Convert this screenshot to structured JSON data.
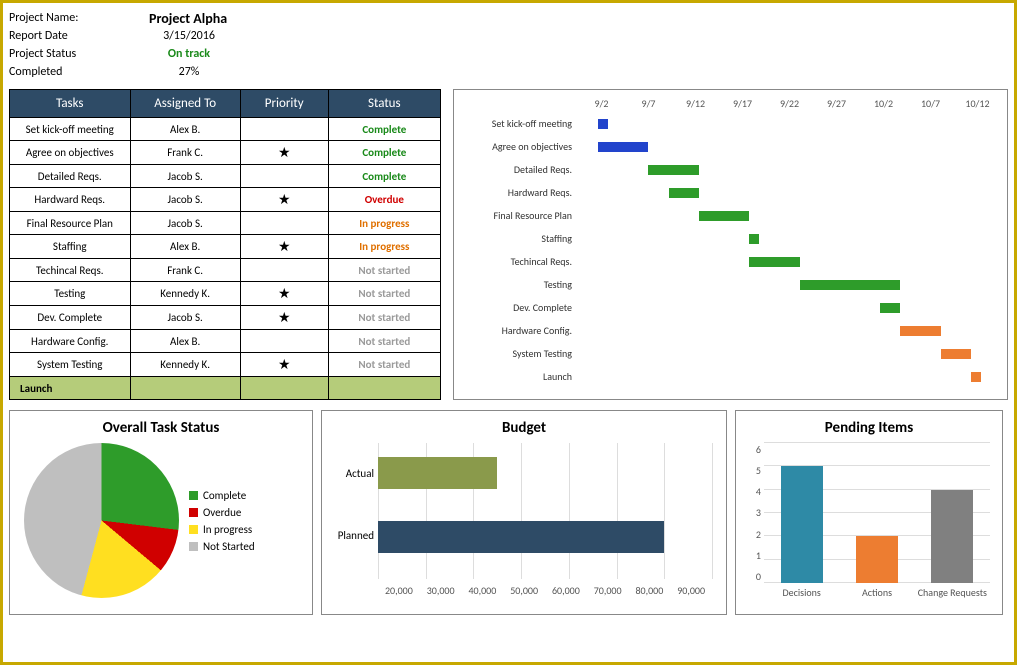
{
  "header": {
    "project_name_label": "Project Name:",
    "project_name": "Project Alpha",
    "report_date_label": "Report Date",
    "report_date": "3/15/2016",
    "project_status_label": "Project Status",
    "project_status": "On track",
    "completed_label": "Completed",
    "completed": "27%"
  },
  "tasks_table": {
    "headers": {
      "tasks": "Tasks",
      "assigned": "Assigned To",
      "priority": "Priority",
      "status": "Status"
    },
    "rows": [
      {
        "task": "Set kick-off meeting",
        "assigned": "Alex B.",
        "priority": "",
        "status": "Complete",
        "status_class": "complete"
      },
      {
        "task": "Agree on objectives",
        "assigned": "Frank C.",
        "priority": "★",
        "status": "Complete",
        "status_class": "complete"
      },
      {
        "task": "Detailed Reqs.",
        "assigned": "Jacob S.",
        "priority": "",
        "status": "Complete",
        "status_class": "complete"
      },
      {
        "task": "Hardward Reqs.",
        "assigned": "Jacob S.",
        "priority": "★",
        "status": "Overdue",
        "status_class": "overdue"
      },
      {
        "task": "Final Resource Plan",
        "assigned": "Jacob S.",
        "priority": "",
        "status": "In progress",
        "status_class": "inprogress"
      },
      {
        "task": "Staffing",
        "assigned": "Alex B.",
        "priority": "★",
        "status": "In progress",
        "status_class": "inprogress"
      },
      {
        "task": "Techincal Reqs.",
        "assigned": "Frank C.",
        "priority": "",
        "status": "Not started",
        "status_class": "notstarted"
      },
      {
        "task": "Testing",
        "assigned": "Kennedy K.",
        "priority": "★",
        "status": "Not started",
        "status_class": "notstarted"
      },
      {
        "task": "Dev. Complete",
        "assigned": "Jacob S.",
        "priority": "★",
        "status": "Not started",
        "status_class": "notstarted"
      },
      {
        "task": "Hardware Config.",
        "assigned": "Alex B.",
        "priority": "",
        "status": "Not started",
        "status_class": "notstarted"
      },
      {
        "task": "System Testing",
        "assigned": "Kennedy K.",
        "priority": "★",
        "status": "Not started",
        "status_class": "notstarted"
      }
    ],
    "launch_label": "Launch"
  },
  "chart_data": [
    {
      "type": "bar",
      "orientation": "horizontal-gantt",
      "title": "",
      "x_ticks": [
        "9/2",
        "9/7",
        "9/12",
        "9/17",
        "9/22",
        "9/27",
        "10/2",
        "10/7",
        "10/12"
      ],
      "tasks": [
        {
          "name": "Set kick-off meeting",
          "start": 2,
          "dur": 1,
          "color": "#2244cc"
        },
        {
          "name": "Agree on objectives",
          "start": 2,
          "dur": 5,
          "color": "#2244cc"
        },
        {
          "name": "Detailed Reqs.",
          "start": 7,
          "dur": 5,
          "color": "#2e9c2a"
        },
        {
          "name": "Hardward Reqs.",
          "start": 9,
          "dur": 3,
          "color": "#2e9c2a"
        },
        {
          "name": "Final Resource Plan",
          "start": 12,
          "dur": 5,
          "color": "#2e9c2a"
        },
        {
          "name": "Staffing",
          "start": 17,
          "dur": 1,
          "color": "#2e9c2a"
        },
        {
          "name": "Techincal Reqs.",
          "start": 17,
          "dur": 5,
          "color": "#2e9c2a"
        },
        {
          "name": "Testing",
          "start": 22,
          "dur": 10,
          "color": "#2e9c2a"
        },
        {
          "name": "Dev. Complete",
          "start": 30,
          "dur": 2,
          "color": "#2e9c2a"
        },
        {
          "name": "Hardware Config.",
          "start": 32,
          "dur": 4,
          "color": "#ed7d31"
        },
        {
          "name": "System Testing",
          "start": 36,
          "dur": 3,
          "color": "#ed7d31"
        },
        {
          "name": "Launch",
          "start": 39,
          "dur": 1,
          "color": "#ed7d31"
        }
      ],
      "x_range_days": 42
    },
    {
      "type": "pie",
      "title": "Overall Task Status",
      "series": [
        {
          "name": "Complete",
          "value": 27,
          "color": "#2e9c2a"
        },
        {
          "name": "Overdue",
          "value": 9,
          "color": "#d00000"
        },
        {
          "name": "In progress",
          "value": 18,
          "color": "#ffdf20"
        },
        {
          "name": "Not Started",
          "value": 46,
          "color": "#bfbfbf"
        }
      ]
    },
    {
      "type": "bar",
      "orientation": "horizontal",
      "title": "Budget",
      "categories": [
        "Actual",
        "Planned"
      ],
      "values": [
        45000,
        80000
      ],
      "colors": [
        "#8a9a4b",
        "#2e4b66"
      ],
      "xlim": [
        20000,
        90000
      ],
      "x_ticks": [
        "20,000",
        "30,000",
        "40,000",
        "50,000",
        "60,000",
        "70,000",
        "80,000",
        "90,000"
      ]
    },
    {
      "type": "bar",
      "orientation": "vertical",
      "title": "Pending Items",
      "categories": [
        "Decisions",
        "Actions",
        "Change Requests"
      ],
      "values": [
        5,
        2,
        4
      ],
      "colors": [
        "#2e8aa6",
        "#ed7d31",
        "#808080"
      ],
      "ylim": [
        0,
        6
      ],
      "y_ticks": [
        "0",
        "1",
        "2",
        "3",
        "4",
        "5",
        "6"
      ]
    }
  ]
}
